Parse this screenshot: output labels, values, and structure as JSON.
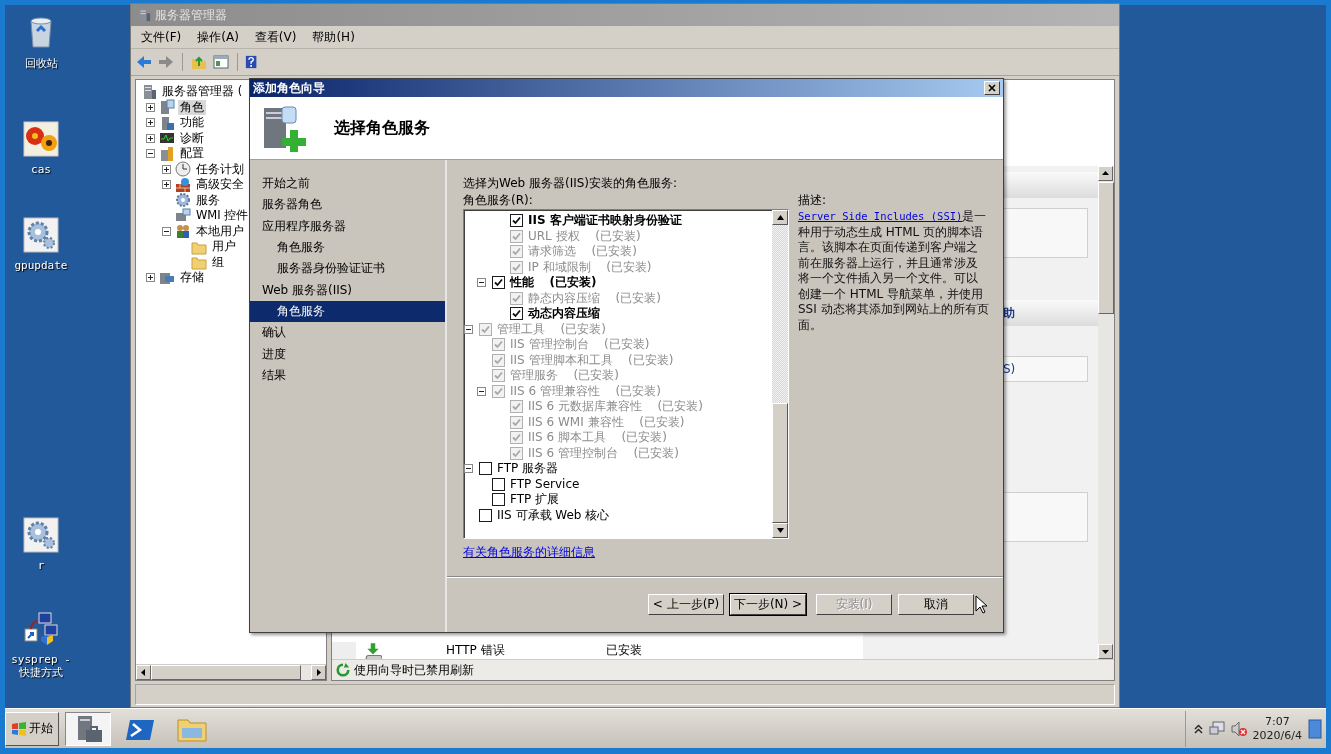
{
  "desktop_icons": [
    {
      "label": "回收站",
      "kind": "recycle"
    },
    {
      "label": "cas",
      "kind": "photo"
    },
    {
      "label": "gpupdate",
      "kind": "gear"
    },
    {
      "label": "r",
      "kind": "gear"
    },
    {
      "label": "sysprep -\n快捷方式",
      "kind": "network"
    }
  ],
  "server_manager": {
    "title": "服务器管理器",
    "menu": [
      "文件(F)",
      "操作(A)",
      "查看(V)",
      "帮助(H)"
    ],
    "tree": [
      {
        "label": "服务器管理器 (",
        "kind": "server",
        "selected": false,
        "children": [
          {
            "label": "角色",
            "kind": "roles",
            "expanded": false,
            "selected": true
          },
          {
            "label": "功能",
            "kind": "features",
            "expanded": false,
            "selected": false
          },
          {
            "label": "诊断",
            "kind": "diagnostics",
            "expanded": false,
            "selected": false
          },
          {
            "label": "配置",
            "kind": "config",
            "expanded": true,
            "selected": false,
            "children": [
              {
                "label": "任务计划",
                "kind": "clock",
                "expanded": false,
                "selected": false
              },
              {
                "label": "高级安全",
                "kind": "firewall",
                "expanded": false,
                "selected": false
              },
              {
                "label": "服务",
                "kind": "gear",
                "selected": false
              },
              {
                "label": "WMI 控件",
                "kind": "wmi",
                "selected": false
              },
              {
                "label": "本地用户",
                "kind": "users",
                "expanded": true,
                "selected": false,
                "children": [
                  {
                    "label": "用户",
                    "kind": "folder",
                    "selected": false
                  },
                  {
                    "label": "组",
                    "kind": "folder",
                    "selected": false
                  }
                ]
              }
            ]
          },
          {
            "label": "存储",
            "kind": "storage",
            "expanded": false,
            "selected": false
          }
        ]
      }
    ],
    "side_panel": {
      "section_title": "助",
      "item": "S)"
    },
    "role_list": [
      {
        "name": "HTTP 错误",
        "status": "已安装"
      }
    ],
    "status": "使用向导时已禁用刷新"
  },
  "wizard": {
    "title": "添加角色向导",
    "heading": "选择角色服务",
    "steps": [
      {
        "label": "开始之前",
        "selected": false
      },
      {
        "label": "服务器角色",
        "selected": false
      },
      {
        "label": "应用程序服务器",
        "selected": false,
        "children": [
          {
            "label": "角色服务",
            "selected": false
          },
          {
            "label": "服务器身份验证证书",
            "selected": false
          }
        ]
      },
      {
        "label": "Web 服务器(IIS)",
        "selected": false,
        "children": [
          {
            "label": "角色服务",
            "selected": true
          }
        ]
      },
      {
        "label": "确认",
        "selected": false
      },
      {
        "label": "进度",
        "selected": false
      },
      {
        "label": "结果",
        "selected": false
      }
    ],
    "instruction": "选择为Web 服务器(IIS)安装的角色服务:",
    "list_label": "角色服务(R):",
    "role_services": [
      {
        "children": [
          {
            "children": [
              {
                "label": "IIS 客户端证书映射身份验证",
                "checked": true,
                "disabled": false
              },
              {
                "label": "URL 授权",
                "status": "(已安装)",
                "checked": true,
                "disabled": true
              },
              {
                "label": "请求筛选",
                "status": "(已安装)",
                "checked": true,
                "disabled": true
              },
              {
                "label": "IP 和域限制",
                "status": "(已安装)",
                "checked": true,
                "disabled": true
              }
            ]
          },
          {
            "label": "性能",
            "status": "(已安装)",
            "checked": true,
            "disabled": false,
            "expanded": true,
            "children": [
              {
                "label": "静态内容压缩",
                "status": "(已安装)",
                "checked": true,
                "disabled": true
              },
              {
                "label": "动态内容压缩",
                "checked": true,
                "disabled": false
              }
            ]
          }
        ]
      },
      {
        "label": "管理工具",
        "status": "(已安装)",
        "checked": true,
        "disabled": true,
        "expanded": true,
        "children": [
          {
            "label": "IIS 管理控制台",
            "status": "(已安装)",
            "checked": true,
            "disabled": true
          },
          {
            "label": "IIS 管理脚本和工具",
            "status": "(已安装)",
            "checked": true,
            "disabled": true
          },
          {
            "label": "管理服务",
            "status": "(已安装)",
            "checked": true,
            "disabled": true
          },
          {
            "label": "IIS 6 管理兼容性",
            "status": "(已安装)",
            "checked": true,
            "disabled": true,
            "expanded": true,
            "children": [
              {
                "label": "IIS 6 元数据库兼容性",
                "status": "(已安装)",
                "checked": true,
                "disabled": true
              },
              {
                "label": "IIS 6 WMI 兼容性",
                "status": "(已安装)",
                "checked": true,
                "disabled": true
              },
              {
                "label": "IIS 6 脚本工具",
                "status": "(已安装)",
                "checked": true,
                "disabled": true
              },
              {
                "label": "IIS 6 管理控制台",
                "status": "(已安装)",
                "checked": true,
                "disabled": true
              }
            ]
          }
        ]
      },
      {
        "label": "FTP 服务器",
        "checked": false,
        "disabled": false,
        "expanded": true,
        "children": [
          {
            "label": "FTP Service",
            "checked": false,
            "disabled": false
          },
          {
            "label": "FTP 扩展",
            "checked": false,
            "disabled": false
          }
        ]
      },
      {
        "label": "IIS 可承载 Web 核心",
        "checked": false,
        "disabled": false
      }
    ],
    "details_link": "有关角色服务的详细信息",
    "description_label": "描述:",
    "description": {
      "link": "Server Side Includes (SSI)",
      "text": "是一种用于动态生成 HTML 页的脚本语言。该脚本在页面传递到客户端之前在服务器上运行，并且通常涉及将一个文件插入另一个文件。可以创建一个 HTML 导航菜单，并使用 SSI 动态将其添加到网站上的所有页面。"
    },
    "buttons": [
      {
        "label": "< 上一步(P)",
        "disabled": false,
        "default": false
      },
      {
        "label": "下一步(N) >",
        "disabled": false,
        "default": true
      },
      {
        "label": "安装(I)",
        "disabled": true,
        "default": false
      },
      {
        "label": "取消",
        "disabled": false,
        "default": false
      }
    ]
  },
  "taskbar": {
    "start": "开始",
    "apps": [
      {
        "kind": "server-manager",
        "selected": true
      },
      {
        "kind": "powershell",
        "selected": false
      },
      {
        "kind": "explorer",
        "selected": false
      }
    ],
    "time": "7:07",
    "date": "2020/6/4"
  }
}
